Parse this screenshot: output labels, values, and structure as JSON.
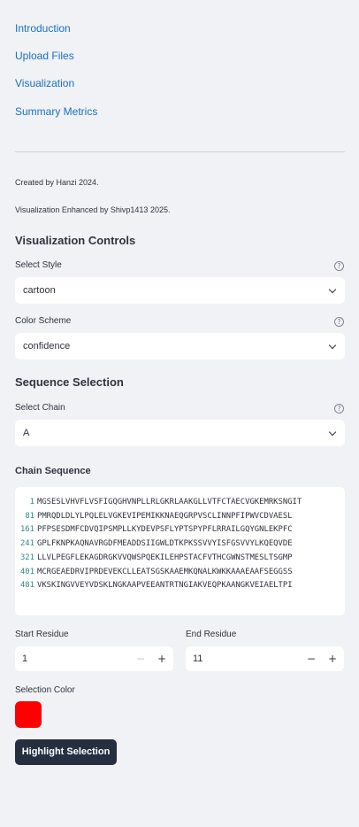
{
  "nav": {
    "items": [
      "Introduction",
      "Upload Files",
      "Visualization",
      "Summary Metrics"
    ]
  },
  "credits": {
    "created": "Created by Hanzi 2024.",
    "enhanced": "Visualization Enhanced by Shivp1413 2025."
  },
  "viz_controls": {
    "heading": "Visualization Controls",
    "style_label": "Select Style",
    "style_value": "cartoon",
    "color_label": "Color Scheme",
    "color_value": "confidence"
  },
  "sequence_selection": {
    "heading": "Sequence Selection",
    "chain_label": "Select Chain",
    "chain_value": "A",
    "sequence_label": "Chain Sequence",
    "lines": [
      {
        "num": "1",
        "seq": "MGSESLVHVFLVSFIGQGHVNPLLRLGKRLAAKGLLVTFCTAECVGKEMRKSNGIT"
      },
      {
        "num": "81",
        "seq": "PMRQDLDLYLPQLELVGKEVIPEMIKKNAEQGRPVSCLINNPFIPWVCDVAESL"
      },
      {
        "num": "161",
        "seq": "PFPSESDMFCDVQIPSMPLLKYDEVPSFLYPTSPYPFLRRAILGQYGNLEKPFC"
      },
      {
        "num": "241",
        "seq": "GPLFKNPKAQNAVRGDFMEADDSIIGWLDTKPKSSVVYISFGSVVYLKQEQVDE"
      },
      {
        "num": "321",
        "seq": "LLVLPEGFLEKAGDRGKVVQWSPQEKILEHPSTACFVTHCGWNSTMESLTSGMP"
      },
      {
        "num": "401",
        "seq": "MCRGEAEDRVIPRDEVEKCLLEATSGSKAAEMKQNALKWKKAAAEAAFSEGGSS"
      },
      {
        "num": "481",
        "seq": "VKSKINGVVEYVDSKLNGKAAPVEEANTRTNGIAKVEQPKAANGKVEIAELTPI"
      }
    ],
    "start_label": "Start Residue",
    "start_value": "1",
    "end_label": "End Residue",
    "end_value": "11",
    "color_label": "Selection Color",
    "color_value": "#ff0000",
    "highlight_button": "Highlight Selection"
  },
  "icons": {
    "help": "question-circle-icon",
    "dropdown": "chevron-down-icon",
    "minus": "minus-icon",
    "plus": "plus-icon"
  },
  "colors": {
    "link": "#1c6fc2",
    "background": "#f0f2f6",
    "button": "#262f40"
  }
}
